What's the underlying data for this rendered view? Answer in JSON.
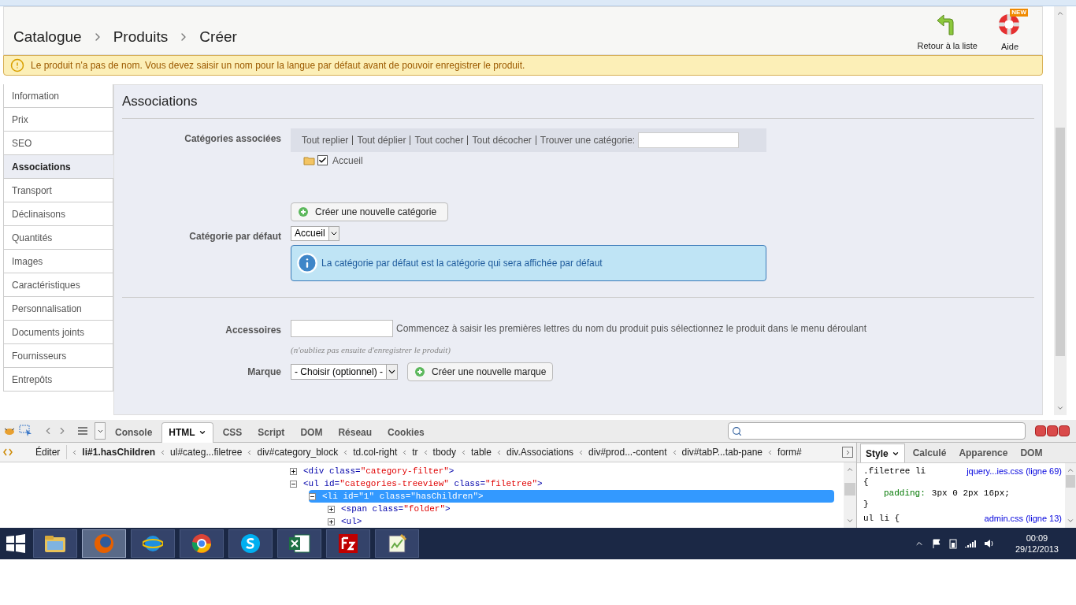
{
  "header": {
    "breadcrumb": [
      "Catalogue",
      "Produits",
      "Créer"
    ],
    "actions": [
      {
        "kind": "back",
        "label": "Retour à la liste"
      },
      {
        "kind": "help",
        "label": "Aide",
        "badge": "NEW"
      }
    ]
  },
  "warning": "Le produit n'a pas de nom. Vous devez saisir un nom pour la langue par défaut avant de pouvoir enregistrer le produit.",
  "tabs": [
    {
      "label": "Information",
      "selected": false
    },
    {
      "label": "Prix",
      "selected": false
    },
    {
      "label": "SEO",
      "selected": false
    },
    {
      "label": "Associations",
      "selected": true
    },
    {
      "label": "Transport",
      "selected": false
    },
    {
      "label": "Déclinaisons",
      "selected": false
    },
    {
      "label": "Quantités",
      "selected": false
    },
    {
      "label": "Images",
      "selected": false
    },
    {
      "label": "Caractéristiques",
      "selected": false
    },
    {
      "label": "Personnalisation",
      "selected": false
    },
    {
      "label": "Documents joints",
      "selected": false
    },
    {
      "label": "Fournisseurs",
      "selected": false
    },
    {
      "label": "Entrepôts",
      "selected": false
    }
  ],
  "section_title": "Associations",
  "categories": {
    "label": "Catégories associées",
    "links": [
      "Tout replier",
      "Tout déplier",
      "Tout cocher",
      "Tout décocher"
    ],
    "search_label": "Trouver une catégorie:",
    "tree": [
      {
        "label": "Accueil",
        "checked": true
      }
    ],
    "create_button": "Créer une nouvelle catégorie"
  },
  "default_category": {
    "label": "Catégorie par défaut",
    "value": "Accueil",
    "info": "La catégorie par défaut est la catégorie qui sera affichée par défaut"
  },
  "accessories": {
    "label": "Accessoires",
    "hint": "Commencez à saisir les premières lettres du nom du produit puis sélectionnez le produit dans le menu déroulant",
    "note": "(n'oubliez pas ensuite d'enregistrer le produit)"
  },
  "brand": {
    "label": "Marque",
    "value": "- Choisir (optionnel) -",
    "button": "Créer une nouvelle marque"
  },
  "devtools": {
    "tabs": [
      {
        "label": "Console",
        "selected": false
      },
      {
        "label": "HTML",
        "selected": true
      },
      {
        "label": "CSS",
        "selected": false
      },
      {
        "label": "Script",
        "selected": false
      },
      {
        "label": "DOM",
        "selected": false
      },
      {
        "label": "Réseau",
        "selected": false
      },
      {
        "label": "Cookies",
        "selected": false
      }
    ],
    "edit_button": "Éditer",
    "crumbs": [
      {
        "label": "li#1.hasChildren",
        "selected": true
      },
      {
        "label": "ul#categ...filetree",
        "selected": false
      },
      {
        "label": "div#category_block",
        "selected": false
      },
      {
        "label": "td.col-right",
        "selected": false
      },
      {
        "label": "tr",
        "selected": false
      },
      {
        "label": "tbody",
        "selected": false
      },
      {
        "label": "table",
        "selected": false
      },
      {
        "label": "div.Associations",
        "selected": false
      },
      {
        "label": "div#prod...-content",
        "selected": false
      },
      {
        "label": "div#tabP...tab-pane",
        "selected": false
      },
      {
        "label": "form#",
        "selected": false
      }
    ],
    "tree": [
      {
        "text": "<div class=\"category-filter\">",
        "expanded": false,
        "selected": false
      },
      {
        "text": "<ul id=\"categories-treeview\" class=\"filetree\">",
        "expanded": true,
        "selected": false,
        "children": [
          {
            "text": "<li id=\"1\" class=\"hasChildren\">",
            "expanded": true,
            "selected": true,
            "children": [
              {
                "text": "<span class=\"folder\">",
                "expanded": false,
                "selected": false
              },
              {
                "text": "<ul>",
                "expanded": false,
                "selected": false
              }
            ]
          }
        ]
      }
    ],
    "side_tabs": [
      {
        "label": "Style",
        "selected": true
      },
      {
        "label": "Calculé",
        "selected": false
      },
      {
        "label": "Apparence",
        "selected": false
      },
      {
        "label": "DOM",
        "selected": false
      }
    ],
    "rules": [
      {
        "selector": ".filetree li",
        "source": "jquery...ies.css (ligne 69)",
        "open": "{",
        "props": [
          {
            "name": "padding:",
            "value": "3px 0 2px 16px;"
          }
        ],
        "close": "}"
      },
      {
        "selector": "ul li {",
        "source": "admin.css (ligne 13)"
      }
    ]
  },
  "taskbar": {
    "apps": [
      {
        "kind": "folder",
        "selected": false
      },
      {
        "kind": "firefox",
        "selected": true
      },
      {
        "kind": "ie",
        "selected": false
      },
      {
        "kind": "chrome",
        "selected": false
      },
      {
        "kind": "skype",
        "selected": false
      },
      {
        "kind": "excel",
        "selected": false
      },
      {
        "kind": "filezilla",
        "selected": false
      },
      {
        "kind": "notepad",
        "selected": false
      }
    ],
    "time": "00:09",
    "date": "29/12/2013"
  }
}
